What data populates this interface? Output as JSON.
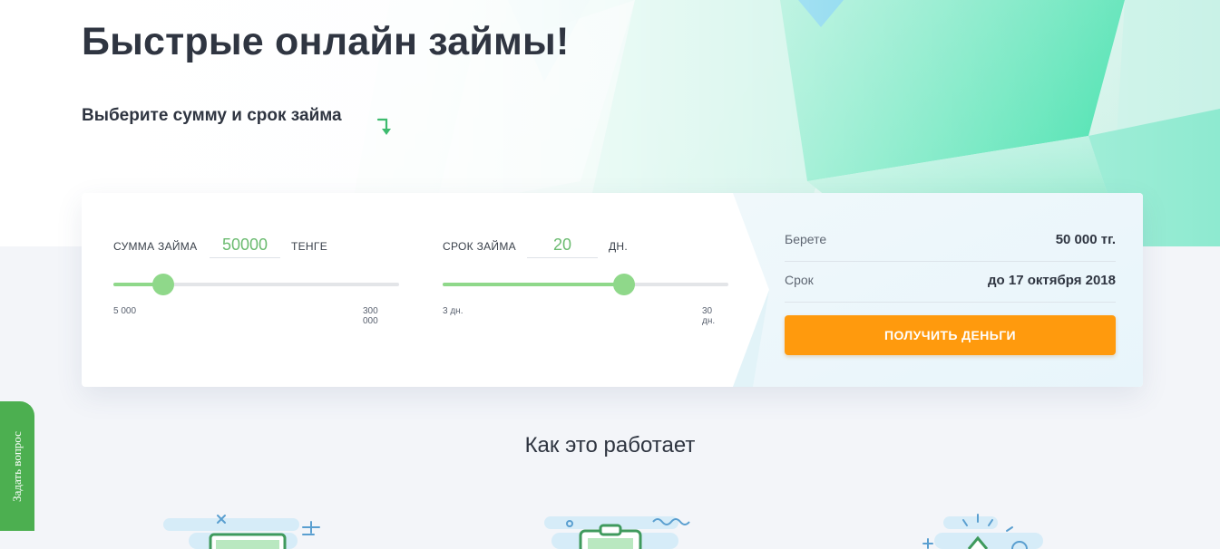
{
  "hero": {
    "title": "Быстрые онлайн займы!",
    "subtitle": "Выберите сумму и срок займа"
  },
  "calculator": {
    "amount": {
      "label": "СУММА ЗАЙМА",
      "value": "50000",
      "unit": "ТЕНГЕ",
      "min_label": "5 000",
      "max_label": "300 000",
      "fill_fraction": 0.175
    },
    "term": {
      "label": "СРОК ЗАЙМА",
      "value": "20",
      "unit": "ДН.",
      "min_label": "3 дн.",
      "max_label": "30 дн.",
      "fill_fraction": 0.635
    },
    "summary": {
      "take_label": "Берете",
      "take_value": "50 000 тг.",
      "term_label": "Срок",
      "term_value": "до 17 октября 2018"
    },
    "cta_label": "ПОЛУЧИТЬ ДЕНЬГИ"
  },
  "how_it_works": {
    "heading": "Как это работает"
  },
  "feedback_tab": {
    "label": "Задать вопрос"
  },
  "colors": {
    "accent_green": "#8fd88a",
    "cta_orange": "#ff9a0d",
    "feedback_green": "#4caf50",
    "value_green": "#6bbb70",
    "text_dark": "#2f3541"
  },
  "icons": [
    "arrow-down-right-icon",
    "card-illustration-icon",
    "clipboard-illustration-icon",
    "rocket-illustration-icon"
  ]
}
